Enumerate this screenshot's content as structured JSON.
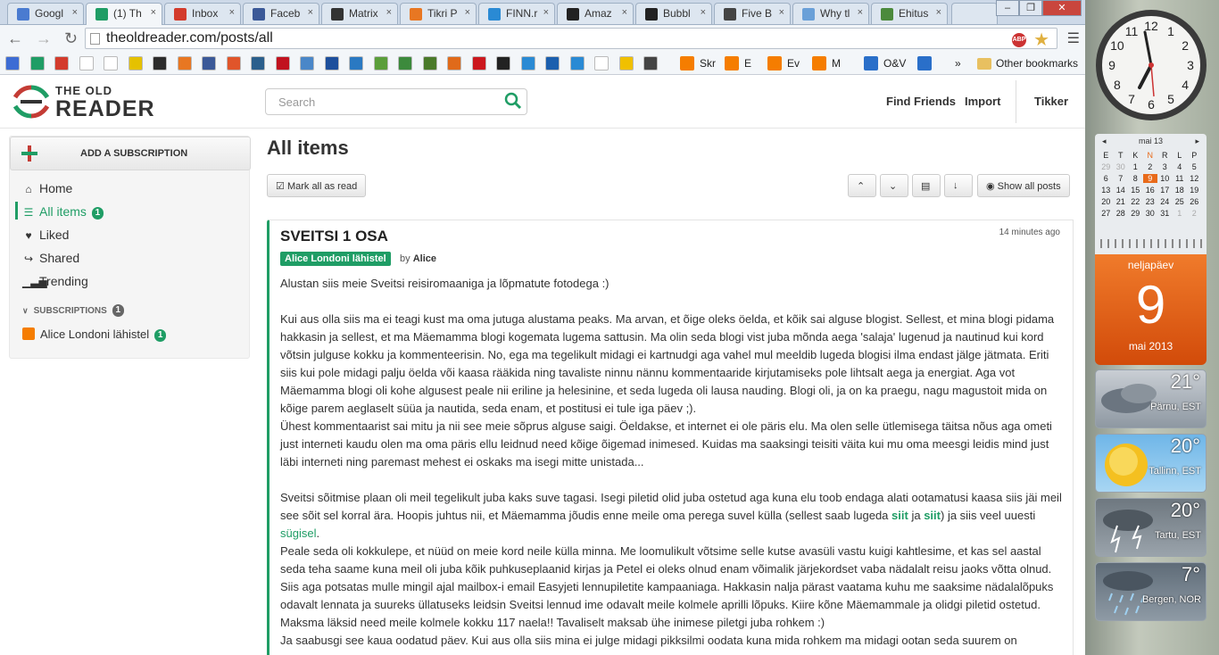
{
  "browser": {
    "tabs": [
      {
        "label": "Googl",
        "color": "#4a7bd0"
      },
      {
        "label": "(1) Th",
        "color": "#1f9d65"
      },
      {
        "label": "Inbox",
        "color": "#d33b2c"
      },
      {
        "label": "Faceb",
        "color": "#3b5998"
      },
      {
        "label": "Matrix",
        "color": "#333333"
      },
      {
        "label": "Tikri P",
        "color": "#e87722"
      },
      {
        "label": "FINN.r",
        "color": "#2a8ad4"
      },
      {
        "label": "Amaz",
        "color": "#222222"
      },
      {
        "label": "Bubbl",
        "color": "#222222"
      },
      {
        "label": "Five B",
        "color": "#444444"
      },
      {
        "label": "Why tl",
        "color": "#6aa0d8"
      },
      {
        "label": "Ehitus",
        "color": "#4c8a3c"
      }
    ],
    "url": "theoldreader.com/posts/all",
    "abp_label": "ABP",
    "bookmarks": {
      "items": [
        {
          "label": "Skr",
          "color": "#f57d00"
        },
        {
          "label": "E",
          "color": "#f57d00"
        },
        {
          "label": "Ev",
          "color": "#f57d00"
        },
        {
          "label": "M",
          "color": "#f57d00"
        },
        {
          "label": "O&V",
          "color": "#2a6fc9"
        }
      ],
      "overflow": "»",
      "other": "Other bookmarks"
    }
  },
  "app": {
    "logo_line1": "THE OLD",
    "logo_line2": "READER",
    "search_placeholder": "Search",
    "header_links": {
      "find_friends": "Find Friends",
      "import": "Import",
      "user": "Tikker"
    },
    "sidebar": {
      "add_subscription": "ADD A SUBSCRIPTION",
      "nav": [
        {
          "label": "Home",
          "icon": "home-icon"
        },
        {
          "label": "All items",
          "icon": "list-icon",
          "count": "1"
        },
        {
          "label": "Liked",
          "icon": "heart-icon"
        },
        {
          "label": "Shared",
          "icon": "share-icon"
        },
        {
          "label": "Trending",
          "icon": "signal-icon"
        }
      ],
      "subscriptions_header": "SUBSCRIPTIONS",
      "subscriptions_count": "1",
      "subscription": {
        "label": "Alice Londoni lähistel",
        "count": "1"
      }
    },
    "main": {
      "title": "All items",
      "mark_all_read": "Mark all as read",
      "show_all_posts": "Show all posts"
    },
    "post": {
      "title": "SVEITSI 1 OSA",
      "time": "14 minutes ago",
      "feed_tag": "Alice Londoni lähistel",
      "by_label": "by",
      "author": "Alice",
      "p1": "Alustan siis meie Sveitsi reisiromaaniga ja lõpmatute fotodega :)",
      "p2": "Kui aus olla siis ma ei teagi kust ma oma jutuga alustama peaks. Ma arvan, et õige oleks öelda, et kõik sai alguse blogist. Sellest, et mina blogi pidama hakkasin ja sellest, et ma Mäemamma blogi kogemata lugema sattusin. Ma olin seda blogi vist juba mõnda aega 'salaja' lugenud ja nautinud kui kord võtsin julguse kokku ja kommenteerisin. No, ega ma tegelikult midagi ei kartnudgi aga vahel mul meeldib lugeda blogisi ilma endast jälge jätmata. Eriti siis kui pole midagi palju öelda või kaasa rääkida ning tavaliste ninnu nännu kommentaaride kirjutamiseks pole lihtsalt aega ja energiat. Aga vot Mäemamma blogi oli kohe algusest peale nii eriline ja helesinine, et seda lugeda oli lausa nauding. Blogi oli, ja on ka praegu, nagu magustoit mida on kõige parem aeglaselt süüa ja nautida, seda enam, et postitusi ei tule iga päev ;).",
      "p3": "Ühest kommentaarist sai mitu ja nii see meie sõprus alguse saigi. Öeldakse, et internet ei ole päris elu. Ma olen selle ütlemisega täitsa nõus aga ometi just interneti kaudu olen ma oma päris ellu leidnud need kõige õigemad inimesed. Kuidas ma saaksingi teisiti väita kui mu oma meesgi leidis mind just läbi interneti ning paremast mehest ei oskaks ma isegi mitte unistada...",
      "p4_a": "Sveitsi sõitmise plaan oli meil tegelikult juba kaks suve tagasi. Isegi piletid olid juba ostetud aga kuna elu toob endaga alati ootamatusi kaasa siis jäi meil see sõit sel korral ära. Hoopis juhtus nii, et Mäemamma jõudis enne meile oma perega suvel külla (sellest saab lugeda",
      "p4_link1": "siit",
      "p4_mid": "ja",
      "p4_link2": "siit",
      "p4_b": ") ja siis veel uuesti",
      "p4_link3": "sügisel",
      "p4_end": ".",
      "p5": "Peale seda oli kokkulepe, et nüüd on meie kord neile külla minna. Me loomulikult võtsime selle kutse avasüli vastu kuigi kahtlesime, et kas sel aastal seda teha saame kuna meil oli juba kõik puhkuseplaanid kirjas ja Petel ei oleks olnud enam võimalik järjekordset vaba nädalalt reisu jaoks võtta olnud. Siis aga potsatas mulle mingil ajal mailbox-i email Easyjeti lennupiletite kampaaniaga. Hakkasin nalja pärast vaatama kuhu me saaksime nädalalõpuks odavalt lennata ja suureks üllatuseks leidsin Sveitsi lennud ime odavalt meile kolmele aprilli lõpuks. Kiire kõne Mäemammale ja olidgi piletid ostetud. Maksma läksid need meile kolmele kokku 117 naela!! Tavaliselt maksab ühe inimese piletgi juba rohkem :)",
      "p6": "Ja saabusgi see kaua oodatud päev. Kui aus olla siis mina ei julge midagi pikksilmi oodata kuna mida rohkem ma midagi ootan seda suurem on"
    }
  },
  "gadgets": {
    "calendar": {
      "month_label": "mai 13",
      "weekdays": [
        "E",
        "T",
        "K",
        "N",
        "R",
        "L",
        "P"
      ],
      "weeks": [
        [
          "29",
          "30",
          "1",
          "2",
          "3",
          "4",
          "5"
        ],
        [
          "6",
          "7",
          "8",
          "9",
          "10",
          "11",
          "12"
        ],
        [
          "13",
          "14",
          "15",
          "16",
          "17",
          "18",
          "19"
        ],
        [
          "20",
          "21",
          "22",
          "23",
          "24",
          "25",
          "26"
        ],
        [
          "27",
          "28",
          "29",
          "30",
          "31",
          "1",
          "2"
        ]
      ],
      "weekday_name": "neljapäev",
      "day": "9",
      "month_year": "mai 2013"
    },
    "weather": [
      {
        "temp": "21°",
        "city": "Pärnu, EST",
        "icon": "cloud-icon"
      },
      {
        "temp": "20°",
        "city": "Tallinn, EST",
        "icon": "sun-icon"
      },
      {
        "temp": "20°",
        "city": "Tartu, EST",
        "icon": "thunder-icon"
      },
      {
        "temp": "7°",
        "city": "Bergen, NOR",
        "icon": "rain-icon"
      }
    ]
  },
  "colors": {
    "accent": "#1f9d65",
    "calendar": "#e86a1a"
  }
}
